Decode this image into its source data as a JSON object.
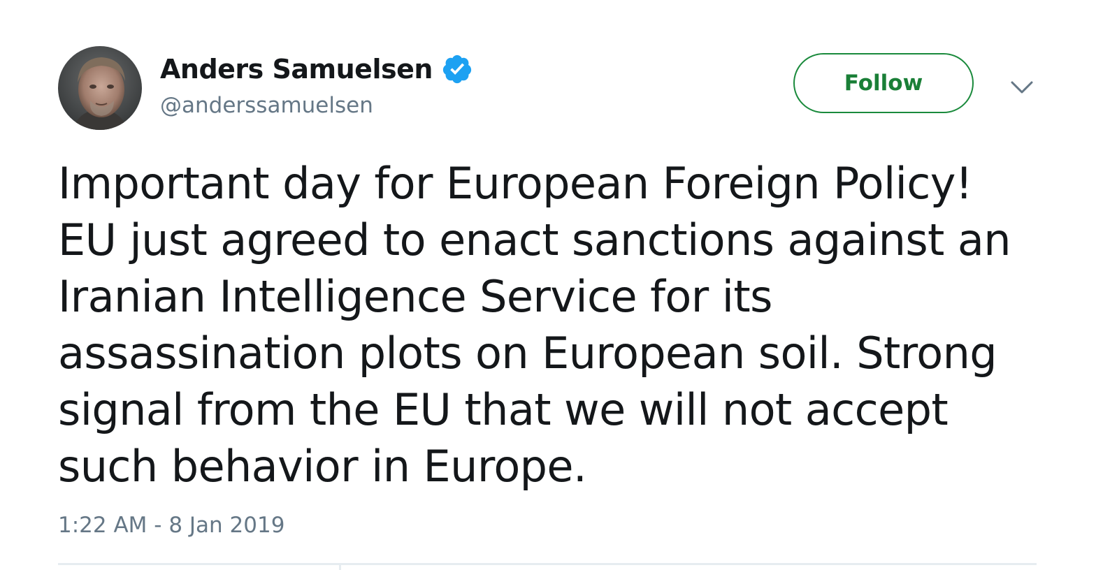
{
  "user": {
    "display_name": "Anders Samuelsen",
    "handle": "@anderssamuelsen",
    "verified": true,
    "avatar_icon": "profile-photo"
  },
  "actions": {
    "follow_label": "Follow",
    "menu_icon": "chevron-down-icon"
  },
  "tweet": {
    "text": "Important day for European Foreign Policy!\nEU just agreed to enact sanctions against an\nIranian Intelligence Service for its\nassassination plots on European soil. Strong\nsignal from the EU that we will not accept\nsuch behavior in Europe.",
    "timestamp": "1:22 AM - 8 Jan 2019"
  },
  "colors": {
    "text": "#14171a",
    "secondary": "#657786",
    "verified_badge": "#1da1f2",
    "follow_accent": "#1a8a3c",
    "divider": "#e6ecf0"
  }
}
